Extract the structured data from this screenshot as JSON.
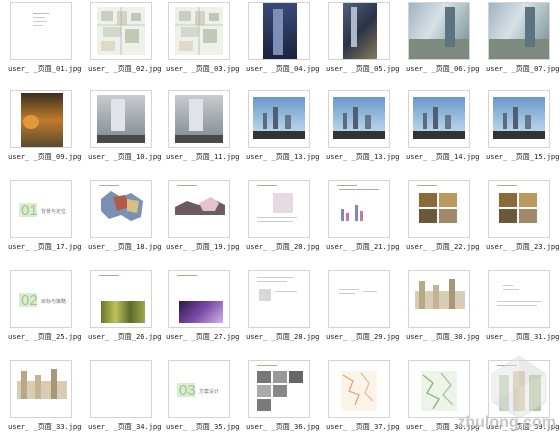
{
  "thumbnails": [
    {
      "caption": "user_ _页面_01.jpg",
      "kind": "text-cover"
    },
    {
      "caption": "user_ _页面_02.jpg",
      "kind": "site-plan"
    },
    {
      "caption": "user_ _页面_03.jpg",
      "kind": "site-plan"
    },
    {
      "caption": "user_ _页面_04.jpg",
      "kind": "night-tower"
    },
    {
      "caption": "user_ _页面_05.jpg",
      "kind": "night-street"
    },
    {
      "caption": "user_ _页面_06.jpg",
      "kind": "glass-street"
    },
    {
      "caption": "user_ _页面_07.jpg",
      "kind": "glass-street"
    },
    {
      "caption": "user_ _页面_09.jpg",
      "kind": "autumn"
    },
    {
      "caption": "user_ _页面_10.jpg",
      "kind": "building"
    },
    {
      "caption": "user_ _页面_11.jpg",
      "kind": "building"
    },
    {
      "caption": "user_ _页面_13.jpg",
      "kind": "skyline"
    },
    {
      "caption": "user_ _页面_13.jpg",
      "kind": "skyline"
    },
    {
      "caption": "user_ _页面_14.jpg",
      "kind": "skyline"
    },
    {
      "caption": "user_ _页面_15.jpg",
      "kind": "skyline"
    },
    {
      "caption": "user_ _页面_17.jpg",
      "kind": "section",
      "num": "01",
      "label": "背景与定位"
    },
    {
      "caption": "user_ _页面_18.jpg",
      "kind": "collage"
    },
    {
      "caption": "user_ _页面_19.jpg",
      "kind": "collage2"
    },
    {
      "caption": "user_ _页面_20.jpg",
      "kind": "map-text"
    },
    {
      "caption": "user_ _页面_21.jpg",
      "kind": "chart"
    },
    {
      "caption": "user_ _页面_22.jpg",
      "kind": "photo-grid"
    },
    {
      "caption": "user_ _页面_23.jpg",
      "kind": "photo-grid"
    },
    {
      "caption": "user_ _页面_25.jpg",
      "kind": "section",
      "num": "02",
      "label": "目标与策略"
    },
    {
      "caption": "user_ _页面_26.jpg",
      "kind": "bamboo"
    },
    {
      "caption": "user_ _页面_27.jpg",
      "kind": "purple"
    },
    {
      "caption": "user_ _页面_28.jpg",
      "kind": "text-map"
    },
    {
      "caption": "user_ _页面_29.jpg",
      "kind": "text-only"
    },
    {
      "caption": "user_ _页面_30.jpg",
      "kind": "elevation"
    },
    {
      "caption": "user_ _页面_31.jpg",
      "kind": "elevation-text"
    },
    {
      "caption": "user_ _页面_33.jpg",
      "kind": "elevation"
    },
    {
      "caption": "user_ _页面_34.jpg",
      "kind": "blank"
    },
    {
      "caption": "user_ _页面_35.jpg",
      "kind": "section",
      "num": "03",
      "label": "方案设计"
    },
    {
      "caption": "user_ _页面_36.jpg",
      "kind": "photo-grid-bw"
    },
    {
      "caption": "user_ _页面_37.jpg",
      "kind": "plan-orange"
    },
    {
      "caption": "user_ _页面_38.jpg",
      "kind": "plan-green"
    },
    {
      "caption": "user_ _页面_39.jpg",
      "kind": "plan-elev"
    }
  ],
  "watermark": {
    "text": "zhulong.com"
  }
}
